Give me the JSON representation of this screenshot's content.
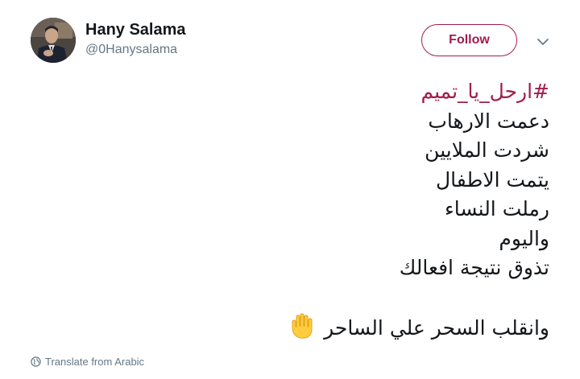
{
  "user": {
    "display_name": "Hany Salama",
    "handle": "@0Hanysalama"
  },
  "follow_label": "Follow",
  "tweet": {
    "hashtag": "#ارحل_يا_تميم",
    "lines": [
      "دعمت الارهاب",
      "شردت الملايين",
      "يتمت الاطفال",
      "رملت النساء",
      "واليوم",
      "تذوق نتيجة افعالك"
    ],
    "closing_line": "وانقلب السحر علي الساحر"
  },
  "translate_label": "Translate from Arabic",
  "icons": {
    "avatar": "profile-photo",
    "caret": "chevron-down-icon",
    "hand": "raised-hand-emoji",
    "globe": "globe-icon"
  },
  "colors": {
    "accent": "#a01d4d",
    "text": "#14171a",
    "muted": "#657786"
  }
}
